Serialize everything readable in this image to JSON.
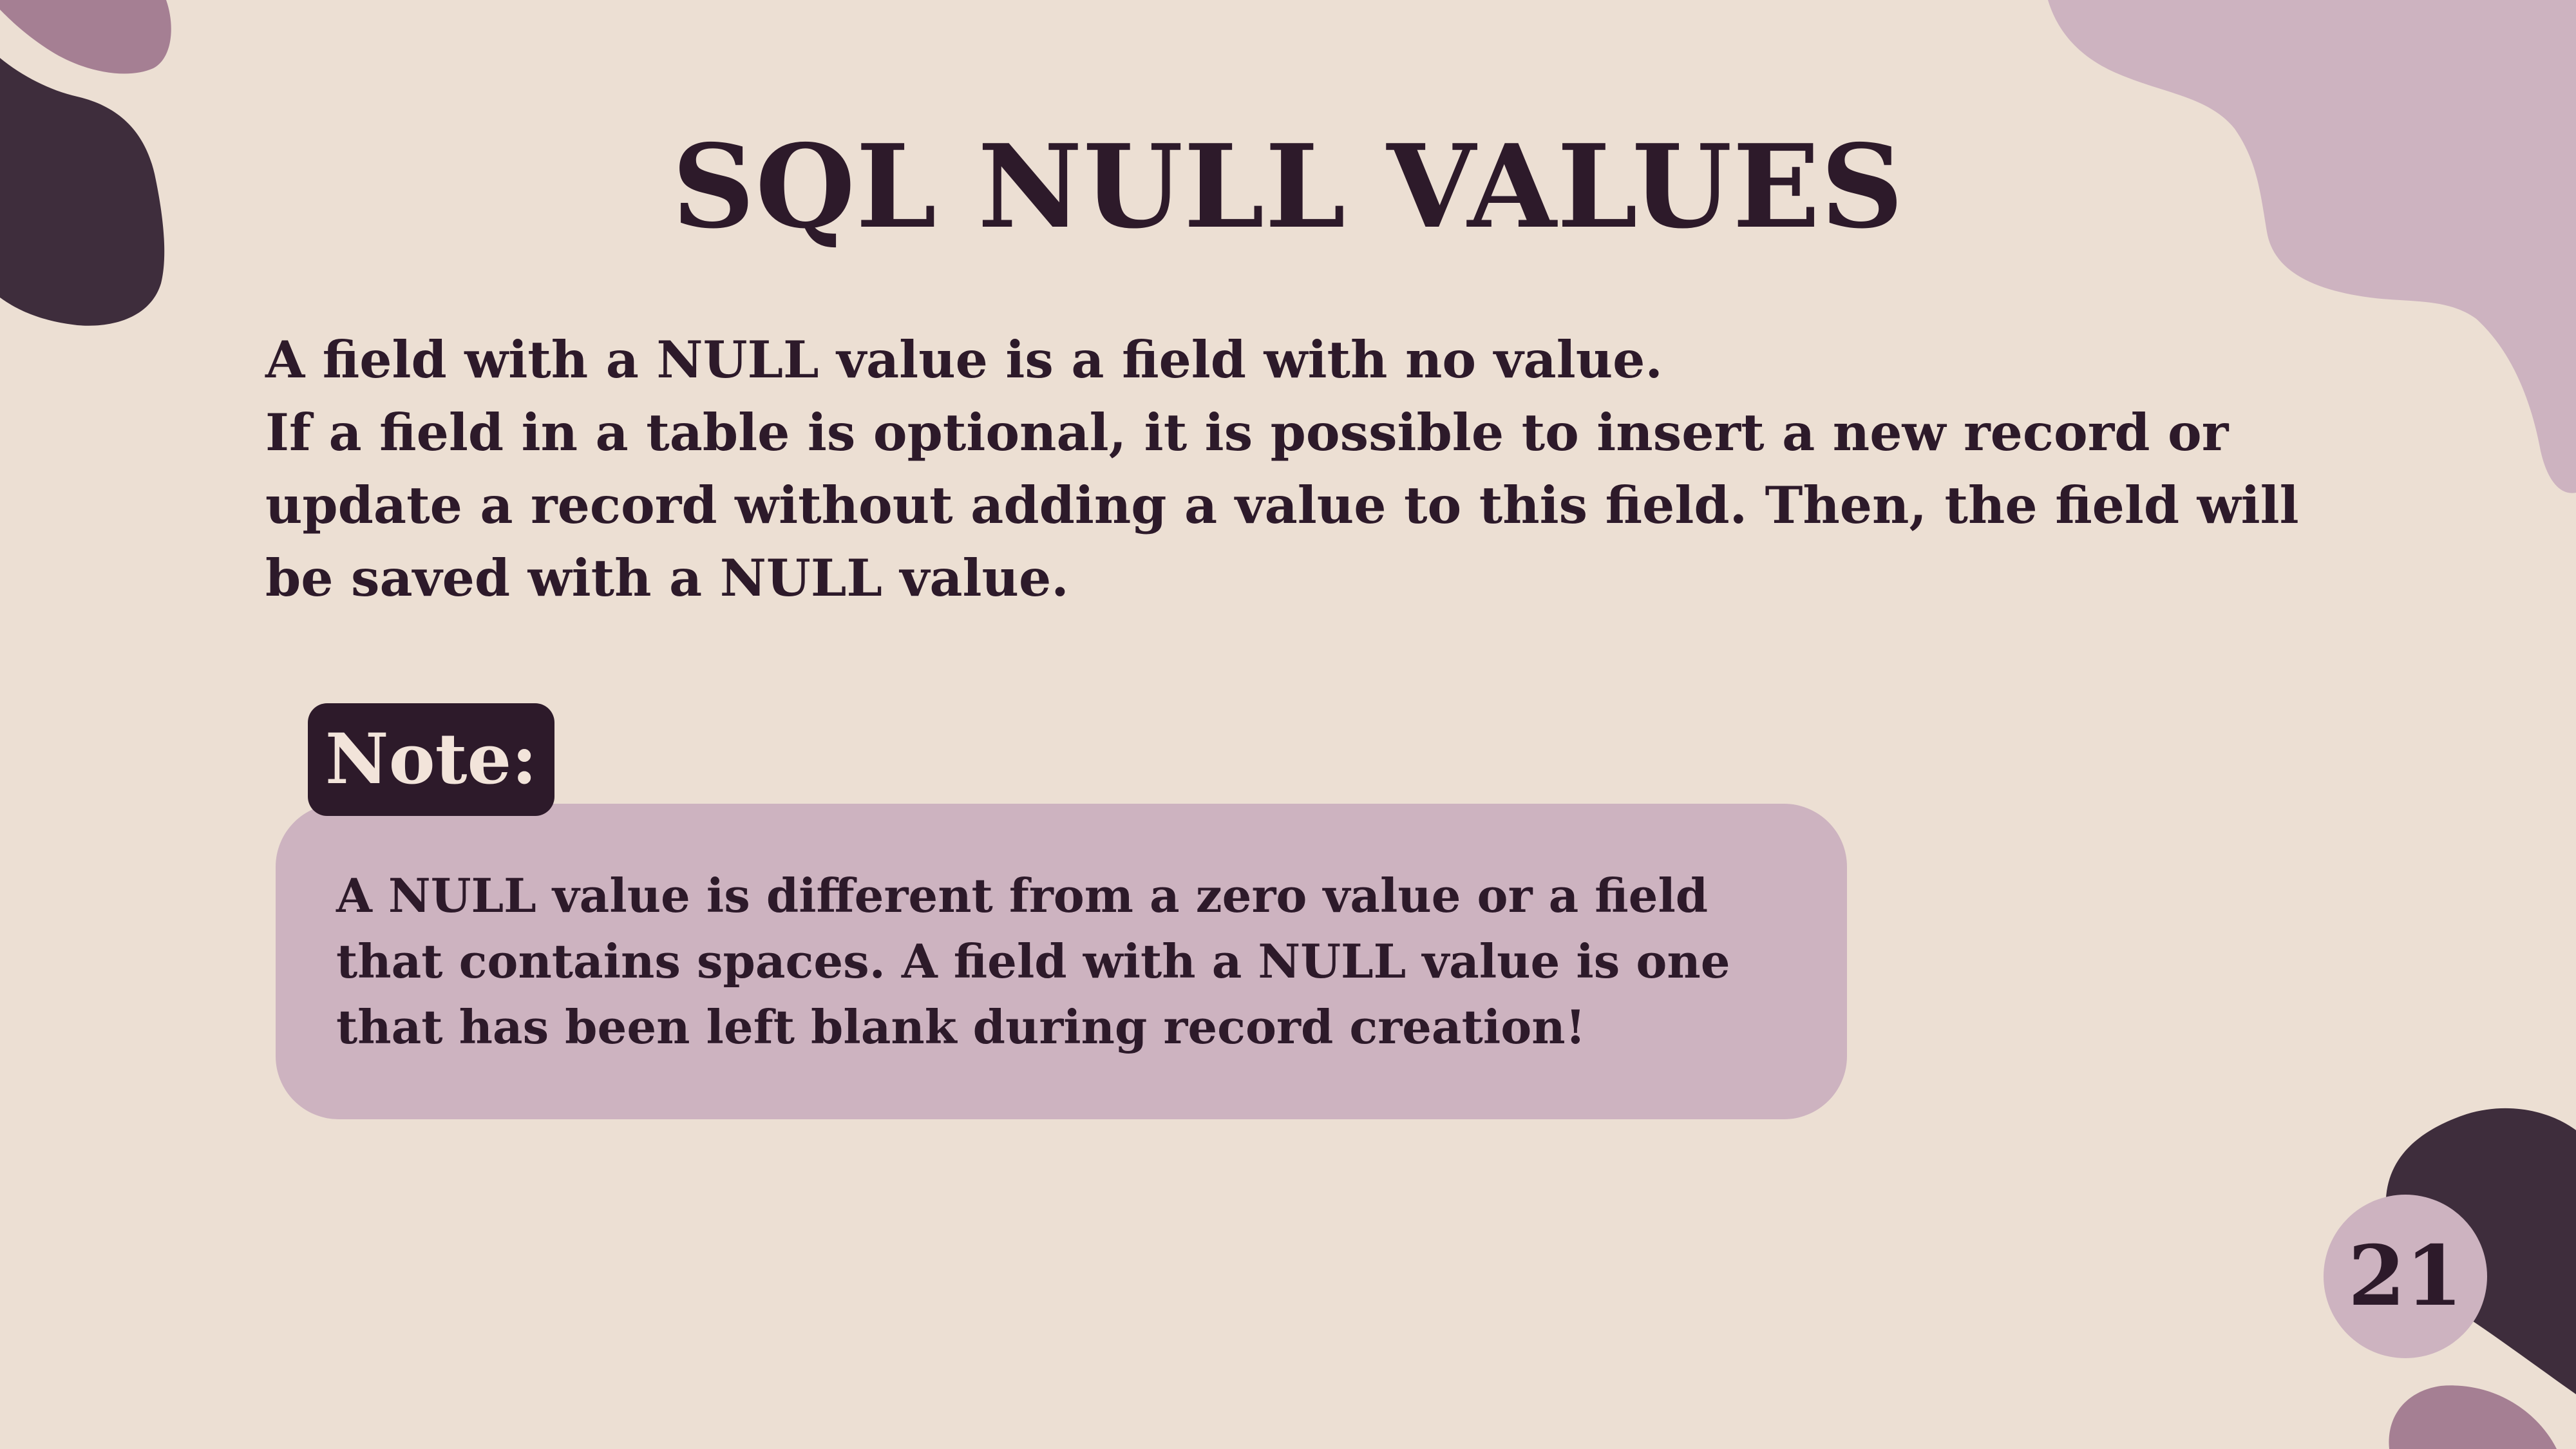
{
  "slide": {
    "title": "SQL NULL VALUES",
    "body": [
      "A field with a NULL value is a field with no value.",
      "If a field in a table is optional, it is possible to insert a new record or update a record without adding a value to this field. Then, the field will be saved with a NULL value."
    ],
    "note": {
      "label": "Note:",
      "text": "A NULL value is different from a zero value or a field that contains spaces. A field with a NULL value is one that has been left blank during record creation!"
    },
    "page_number": "21"
  },
  "colors": {
    "background": "#ecdfd3",
    "text_dark": "#2d1a2a",
    "blob_dark": "#3e2d3c",
    "blob_light": "#cdb3c0",
    "blob_mid": "#a57f93",
    "note_box": "#cdb3c0",
    "note_label_bg": "#2d1a2a",
    "note_label_text": "#f2e4da"
  }
}
